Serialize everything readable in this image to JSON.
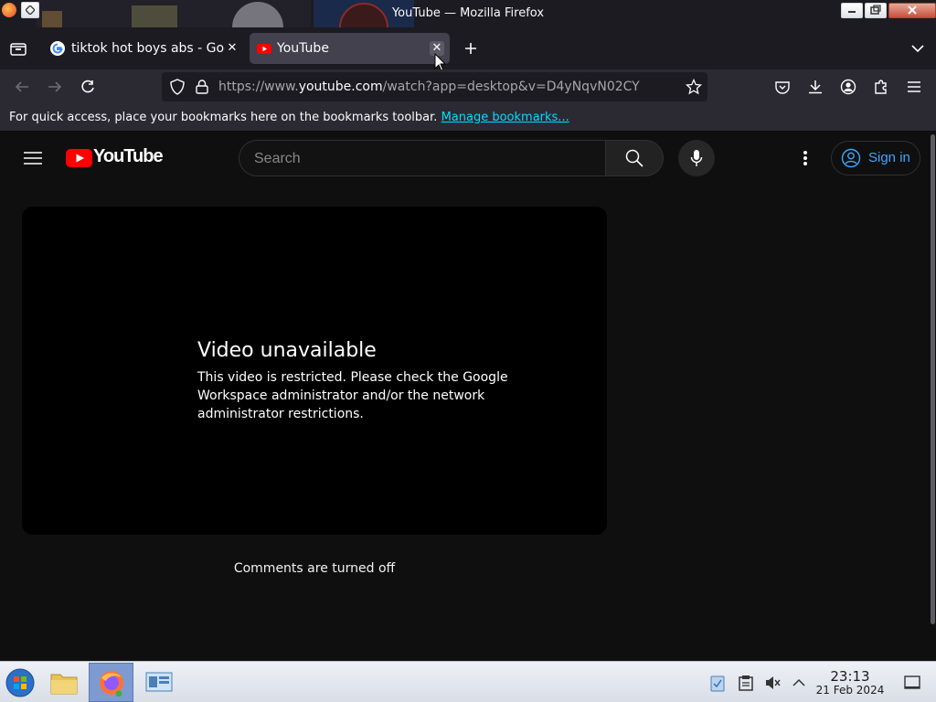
{
  "window": {
    "title": "YouTube — Mozilla Firefox"
  },
  "tabs": [
    {
      "label": "tiktok hot boys abs - Goo",
      "active": false,
      "favicon": "google-icon"
    },
    {
      "label": "YouTube",
      "active": true,
      "favicon": "youtube-icon"
    }
  ],
  "urlbar": {
    "prefix": "https://www.",
    "domain": "youtube.com",
    "path": "/watch?app=desktop&v=D4yNqvN02CY"
  },
  "bookmarks_bar": {
    "message": "For quick access, place your bookmarks here on the bookmarks toolbar.",
    "link": "Manage bookmarks..."
  },
  "youtube": {
    "logo_text": "YouTube",
    "search_placeholder": "Search",
    "sign_in_label": "Sign in",
    "player": {
      "heading": "Video unavailable",
      "message": "This video is restricted. Please check the Google Workspace administrator and/or the network administrator restrictions."
    },
    "comments_status": "Comments are turned off"
  },
  "taskbar": {
    "time": "23:13",
    "date": "21 Feb 2024"
  },
  "colors": {
    "youtube_red": "#ff0000",
    "link_blue": "#3ea6ff",
    "bookmark_link": "#00ddff",
    "browser_chrome": "#2b2a33",
    "page_bg": "#0f0f0f"
  }
}
